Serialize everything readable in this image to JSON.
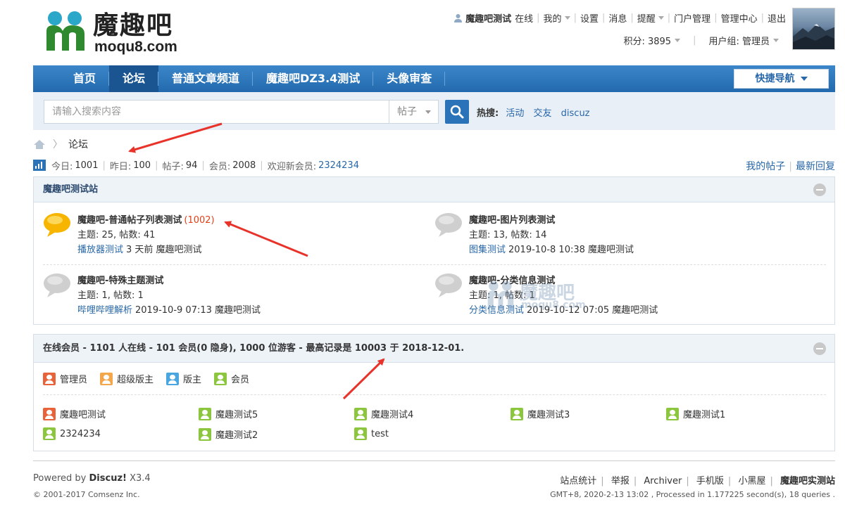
{
  "logo": {
    "cn": "魔趣吧",
    "en": "moqu8.com"
  },
  "userbar": {
    "username": "魔趣吧测试",
    "status": "在线",
    "links": [
      "我的",
      "设置",
      "消息",
      "提醒",
      "门户管理",
      "管理中心",
      "退出"
    ],
    "points": "积分: 3895",
    "group": "用户组: 管理员"
  },
  "nav": {
    "items": [
      "首页",
      "论坛",
      "普通文章频道",
      "魔趣吧DZ3.4测试",
      "头像审查"
    ],
    "active": "论坛",
    "quick": "快捷导航"
  },
  "search": {
    "placeholder": "请输入搜索内容",
    "type": "帖子",
    "hot_label": "热搜:",
    "hot": [
      "活动",
      "交友",
      "discuz"
    ]
  },
  "breadcrumb": {
    "current": "论坛"
  },
  "stats": {
    "today_label": "今日:",
    "today": "1001",
    "yesterday_label": "昨日:",
    "yesterday": "100",
    "posts_label": "帖子:",
    "posts": "94",
    "members_label": "会员:",
    "members": "2008",
    "newmember_label": "欢迎新会员:",
    "newmember": "2324234"
  },
  "right_links": [
    "我的帖子",
    "最新回复"
  ],
  "category": {
    "title": "魔趣吧测试站",
    "forums": [
      {
        "name": "魔趣吧-普通帖子列表测试",
        "today": "(1002)",
        "counts": "主题: 25, 帖数: 41",
        "last_title": "播放器测试",
        "last_meta": "3 天前 魔趣吧测试",
        "active": true
      },
      {
        "name": "魔趣吧-图片列表测试",
        "today": "",
        "counts": "主题: 13, 帖数: 14",
        "last_title": "图集测试",
        "last_meta": "2019-10-8 10:38 魔趣吧测试",
        "active": false
      },
      {
        "name": "魔趣吧-特殊主题测试",
        "today": "",
        "counts": "主题: 1, 帖数: 1",
        "last_title": "哔哩哔哩解析",
        "last_meta": "2019-10-9 07:13 魔趣吧测试",
        "active": false
      },
      {
        "name": "魔趣吧-分类信息测试",
        "today": "",
        "counts": "主题: 1, 帖数: 1",
        "last_title": "分类信息测试",
        "last_meta": "2019-10-12 07:05 魔趣吧测试",
        "active": false
      }
    ]
  },
  "online": {
    "title": "在线会员 - 1101 人在线 - 101 会员(0 隐身), 1000 位游客 - 最高记录是 10003 于 2018-12-01.",
    "legend": [
      "管理员",
      "超级版主",
      "版主",
      "会员"
    ],
    "members": [
      {
        "name": "魔趣吧测试",
        "role": "admin"
      },
      {
        "name": "魔趣测试5",
        "role": "member"
      },
      {
        "name": "魔趣测试4",
        "role": "member"
      },
      {
        "name": "魔趣测试3",
        "role": "member"
      },
      {
        "name": "魔趣测试1",
        "role": "member"
      },
      {
        "name": "2324234",
        "role": "member"
      },
      {
        "name": "魔趣测试2",
        "role": "member"
      },
      {
        "name": "test",
        "role": "member"
      }
    ]
  },
  "watermark": {
    "cn": "魔趣吧",
    "en": "moqu8.com"
  },
  "footer": {
    "powered_prefix": "Powered by",
    "powered_brand": "Discuz!",
    "powered_version": "X3.4",
    "copyright": "© 2001-2017 Comsenz Inc.",
    "links": [
      "站点统计",
      "举报",
      "Archiver",
      "手机版",
      "小黑屋"
    ],
    "site": "魔趣吧实测站",
    "timing": "GMT+8, 2020-2-13 13:02 , Processed in 1.177225 second(s), 18 queries ."
  },
  "colors": {
    "nav": "#2b73b8",
    "link": "#2867a8",
    "today": "#e0401a",
    "arrow": "#e8332a"
  }
}
